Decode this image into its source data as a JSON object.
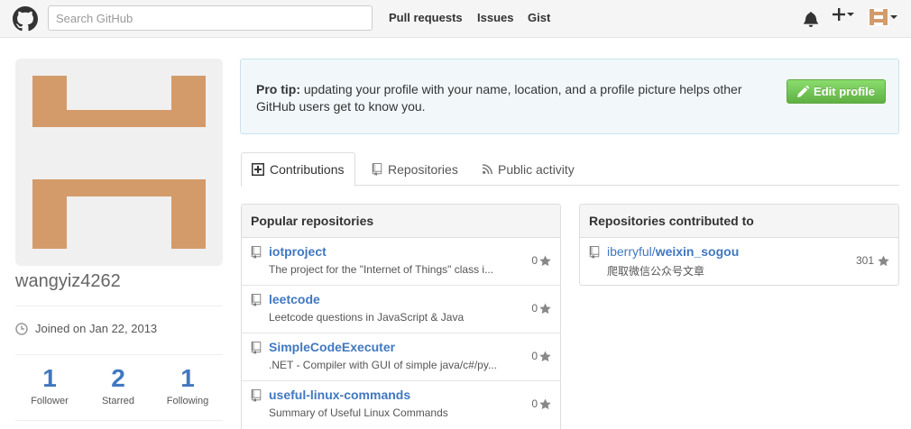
{
  "header": {
    "search_placeholder": "Search GitHub",
    "nav": [
      "Pull requests",
      "Issues",
      "Gist"
    ],
    "icons": [
      "github-logo-icon",
      "bell-icon",
      "plus-icon",
      "avatar-icon"
    ]
  },
  "profile": {
    "username": "wangyiz4262",
    "joined": "Joined on Jan 22, 2013",
    "stats": [
      {
        "num": "1",
        "label": "Follower"
      },
      {
        "num": "2",
        "label": "Starred"
      },
      {
        "num": "1",
        "label": "Following"
      }
    ],
    "avatar_color": "#d39b6a"
  },
  "protip": {
    "bold": "Pro tip:",
    "text": " updating your profile with your name, location, and a profile picture helps other GitHub users get to know you.",
    "button": "Edit profile"
  },
  "tabs": [
    "Contributions",
    "Repositories",
    "Public activity"
  ],
  "popular": {
    "title": "Popular repositories",
    "repos": [
      {
        "name": "iotproject",
        "desc": "The project for the \"Internet of Things\" class i...",
        "stars": "0"
      },
      {
        "name": "leetcode",
        "desc": "Leetcode questions in JavaScript & Java",
        "stars": "0"
      },
      {
        "name": "SimpleCodeExecuter",
        "desc": ".NET - Compiler with GUI of simple java/c#/py...",
        "stars": "0"
      },
      {
        "name": "useful-linux-commands",
        "desc": "Summary of Useful Linux Commands",
        "stars": "0"
      }
    ]
  },
  "contributed": {
    "title": "Repositories contributed to",
    "repos": [
      {
        "owner": "iberryful/",
        "name": "weixin_sogou",
        "desc": "爬取微信公众号文章",
        "stars": "301"
      }
    ]
  },
  "colors": {
    "link": "#4078c0",
    "green": "#6cc644"
  }
}
